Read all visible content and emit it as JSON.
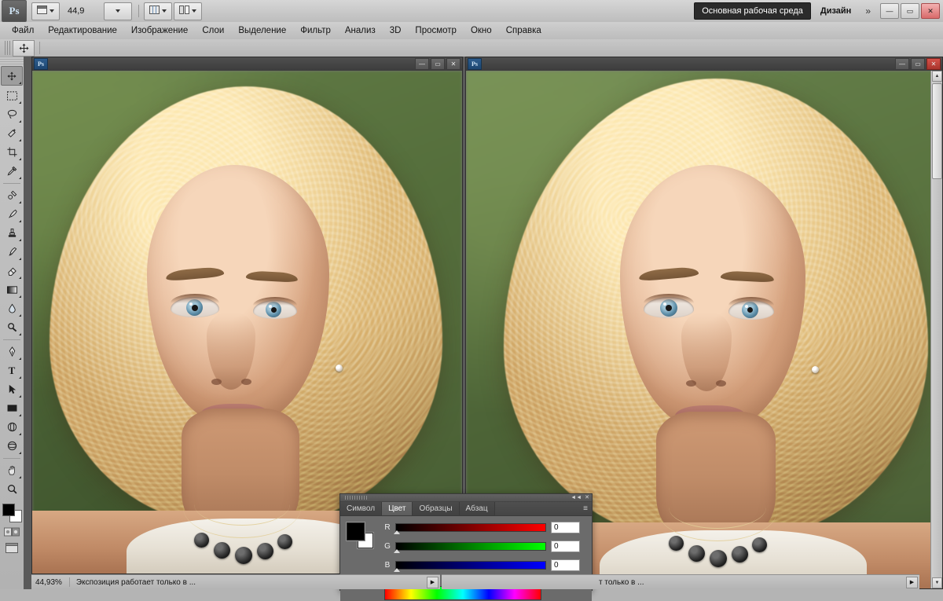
{
  "app": {
    "logo_text": "Ps",
    "title": "Adobe Photoshop"
  },
  "appbar": {
    "zoom_value": "44,9",
    "workspace_button": "Основная рабочая среда",
    "workspace_label": "Дизайн",
    "chevron": "»",
    "icons": {
      "screen_mode": "screen-mode-icon",
      "view_extras": "view-extras-icon",
      "arrange_documents": "arrange-documents-icon"
    },
    "window_buttons": {
      "minimize": "—",
      "maximize": "▭",
      "close": "✕"
    }
  },
  "menubar": {
    "items": [
      {
        "label": "Файл"
      },
      {
        "label": "Редактирование"
      },
      {
        "label": "Изображение"
      },
      {
        "label": "Слои"
      },
      {
        "label": "Выделение"
      },
      {
        "label": "Фильтр"
      },
      {
        "label": "Анализ"
      },
      {
        "label": "3D"
      },
      {
        "label": "Просмотр"
      },
      {
        "label": "Окно"
      },
      {
        "label": "Справка"
      }
    ]
  },
  "options_bar": {
    "active_tool_icon": "move-tool-icon"
  },
  "toolbar": {
    "tools": [
      {
        "name": "move-tool",
        "glyph": "✥",
        "has_flyout": false,
        "selected": true
      },
      {
        "name": "marquee-tool",
        "glyph": "▭",
        "has_flyout": true,
        "selected": false
      },
      {
        "name": "lasso-tool",
        "glyph": "♆",
        "has_flyout": true,
        "selected": false
      },
      {
        "name": "quick-selection-tool",
        "glyph": "✦",
        "has_flyout": true,
        "selected": false
      },
      {
        "name": "crop-tool",
        "glyph": "⌗",
        "has_flyout": true,
        "selected": false
      },
      {
        "name": "eyedropper-tool",
        "glyph": "✎",
        "has_flyout": true,
        "selected": false
      },
      {
        "name": "spot-healing-tool",
        "glyph": "✚",
        "has_flyout": true,
        "selected": false
      },
      {
        "name": "brush-tool",
        "glyph": "✒",
        "has_flyout": true,
        "selected": false
      },
      {
        "name": "clone-stamp-tool",
        "glyph": "⎙",
        "has_flyout": true,
        "selected": false
      },
      {
        "name": "history-brush-tool",
        "glyph": "❧",
        "has_flyout": true,
        "selected": false
      },
      {
        "name": "eraser-tool",
        "glyph": "◧",
        "has_flyout": true,
        "selected": false
      },
      {
        "name": "gradient-tool",
        "glyph": "▤",
        "has_flyout": true,
        "selected": false
      },
      {
        "name": "blur-tool",
        "glyph": "◉",
        "has_flyout": true,
        "selected": false
      },
      {
        "name": "dodge-tool",
        "glyph": "◐",
        "has_flyout": true,
        "selected": false
      },
      {
        "name": "pen-tool",
        "glyph": "✐",
        "has_flyout": true,
        "selected": false
      },
      {
        "name": "type-tool",
        "glyph": "T",
        "has_flyout": true,
        "selected": false
      },
      {
        "name": "path-selection-tool",
        "glyph": "↖",
        "has_flyout": true,
        "selected": false
      },
      {
        "name": "rectangle-tool",
        "glyph": "▬",
        "has_flyout": true,
        "selected": false
      },
      {
        "name": "3d-rotate-tool",
        "glyph": "◍",
        "has_flyout": true,
        "selected": false
      },
      {
        "name": "3d-orbit-tool",
        "glyph": "◎",
        "has_flyout": true,
        "selected": false
      },
      {
        "name": "hand-tool",
        "glyph": "✋",
        "has_flyout": true,
        "selected": false
      },
      {
        "name": "zoom-tool",
        "glyph": "🔍",
        "has_flyout": false,
        "selected": false
      }
    ],
    "foreground_color": "#000000",
    "background_color": "#ffffff",
    "quick_mask_icon": "quick-mask-icon",
    "screen_mode_icon": "screen-mode-icon"
  },
  "documents": [
    {
      "id": "left",
      "tab_icon": "Ps",
      "title": "",
      "window_buttons": {
        "minimize": "—",
        "maximize": "▭",
        "close": "✕"
      },
      "status": {
        "zoom": "44,93%",
        "message": "Экспозиция работает только в ...",
        "arrow": "▶"
      }
    },
    {
      "id": "right",
      "tab_icon": "Ps",
      "title": "",
      "window_buttons": {
        "minimize": "—",
        "maximize": "▭",
        "close": "✕"
      },
      "status": {
        "zoom": "",
        "message": "т только в ...",
        "arrow": "▶"
      }
    }
  ],
  "color_panel": {
    "tabs": [
      {
        "label": "Символ",
        "active": false
      },
      {
        "label": "Цвет",
        "active": true
      },
      {
        "label": "Образцы",
        "active": false
      },
      {
        "label": "Абзац",
        "active": false
      }
    ],
    "menu_icon": "panel-menu-icon",
    "collapse_icon": "collapse-icon",
    "close_icon": "close-icon",
    "foreground_color": "#000000",
    "background_color": "#ffffff",
    "sliders": [
      {
        "label": "R",
        "value": "0",
        "track": "red"
      },
      {
        "label": "G",
        "value": "0",
        "track": "green"
      },
      {
        "label": "B",
        "value": "0",
        "track": "blue"
      }
    ],
    "spectrum_name": "color-spectrum-ramp"
  },
  "colors": {
    "appbar_bg": "#c8c8c8",
    "panel_bg": "#6b6b6b",
    "canvas_bg": "#5a5a5a",
    "workspace_button_bg": "#2b2b2b",
    "accent_close": "#c0392b"
  }
}
